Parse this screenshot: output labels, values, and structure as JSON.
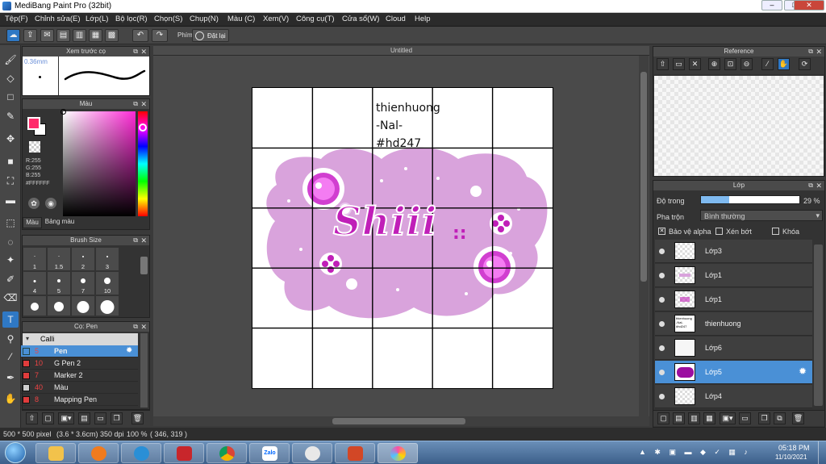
{
  "window": {
    "title": "MediBang Paint Pro (32bit)"
  },
  "menu": [
    "Tệp(F)",
    "Chỉnh sửa(E)",
    "Lớp(L)",
    "Bộ lọc(R)",
    "Chọn(S)",
    "Chụp(N)",
    "Màu (C)",
    "Xem(V)",
    "Công cụ(T)",
    "Cửa sổ(W)",
    "Cloud",
    "Help"
  ],
  "toolbar": {
    "key_label": "Phím",
    "reset_label": "Đặt lại"
  },
  "brush_preview": {
    "title": "Xem trước cọ",
    "size": "0.36mm"
  },
  "color_panel": {
    "title": "Màu",
    "r": "R:255",
    "g": "G:255",
    "b": "B:255",
    "hex": "#FFFFFF",
    "tab_color": "Màu",
    "tab_palette": "Bảng màu",
    "primary": "#ff2a6a",
    "secondary": "#ffffff"
  },
  "brush_size": {
    "title": "Brush Size",
    "sizes": [
      "1",
      "1.5",
      "2",
      "3",
      "4",
      "5",
      "7",
      "10"
    ]
  },
  "brush_list": {
    "title": "Cọ: Pen",
    "group": "Calli",
    "items": [
      {
        "num": "5",
        "name": "Pen"
      },
      {
        "num": "10",
        "name": "G Pen 2"
      },
      {
        "num": "7",
        "name": "Marker 2"
      },
      {
        "num": "40",
        "name": "Màu"
      },
      {
        "num": "8",
        "name": "Mapping Pen"
      }
    ]
  },
  "canvas": {
    "tab_title": "Untitled",
    "text_lines": [
      "thienhuong",
      "-Nal-",
      "#hd247"
    ],
    "art_text": "Shiii",
    "art_marks": "::"
  },
  "reference": {
    "title": "Reference"
  },
  "layers": {
    "title": "Lớp",
    "opacity_label": "Độ trong",
    "opacity_value": "29 %",
    "opacity": 0.29,
    "blend_label": "Pha trộn",
    "blend_value": "Bình thường",
    "protect_alpha": "Bảo vệ alpha",
    "clip": "Xén bớt",
    "lock": "Khóa",
    "items": [
      "Lớp3",
      "Lớp1",
      "Lớp1",
      "thienhuong",
      "Lớp6",
      "Lớp5",
      "Lớp4"
    ],
    "thumb_text": [
      "thienhuong",
      "-Nal-",
      "#hd247"
    ]
  },
  "status": {
    "size": "500 * 500 pixel",
    "cm": "(3.6 * 3.6cm)",
    "dpi": "350 dpi",
    "zoom": "100 %",
    "coords": "( 346, 319 )"
  },
  "taskbar": {
    "time": "05:18 PM",
    "date": "11/10/2021",
    "zalo": "Zalo"
  },
  "colors": {
    "accent": "#4a90d6",
    "art_pink": "#d9a3dc",
    "art_magenta": "#c01fb8"
  }
}
